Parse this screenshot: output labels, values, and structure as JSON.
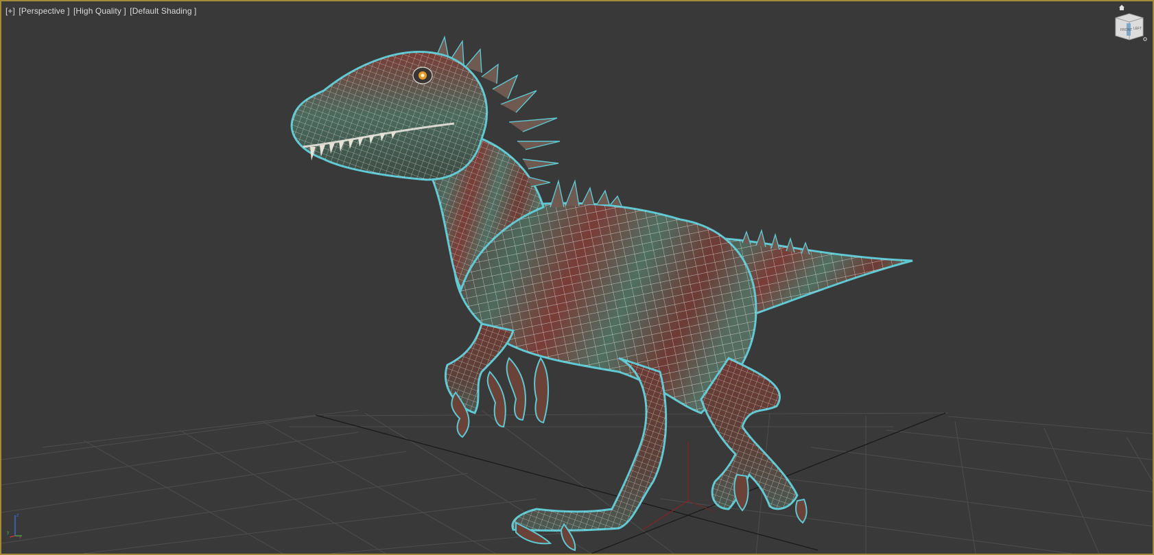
{
  "viewport": {
    "labels": {
      "menu": "[+]",
      "view": "[Perspective ]",
      "quality": "[High Quality ]",
      "shading": "[Default Shading ]"
    },
    "colors": {
      "background": "#393939",
      "active_border": "#a48a3a",
      "grid": "#4d4d4d",
      "grid_dark": "#1e1e1e",
      "selection_outline": "#5fc8d2",
      "skin_green": "#4f6f62",
      "skin_red": "#7a3c36",
      "wire": "#e8e8e8"
    },
    "viewcube": {
      "front_face": "FRONT",
      "left_face": "LEFT",
      "icon": "viewcube-icon"
    },
    "tripod": {
      "x": "x",
      "y": "y",
      "z": "z"
    },
    "model": {
      "icon": "dinosaur-model"
    }
  }
}
